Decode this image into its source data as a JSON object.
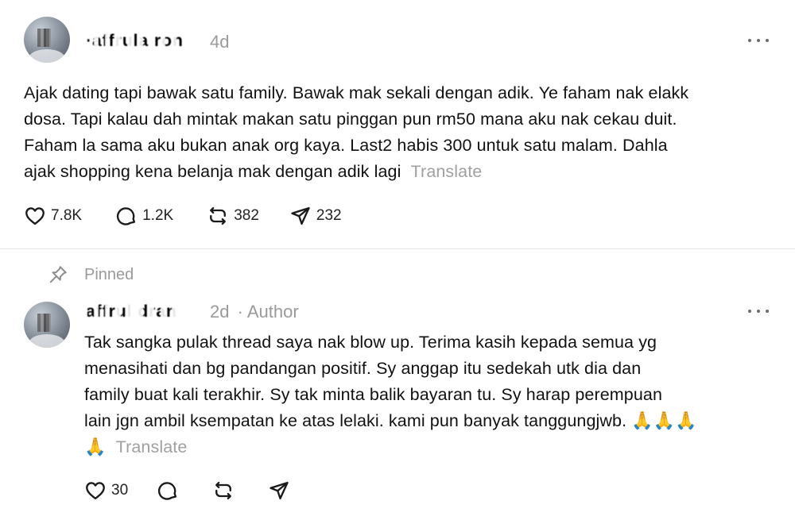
{
  "post1": {
    "username": "·affrula ron",
    "time": "4d",
    "lines": [
      "Ajak dating tapi bawak satu family. Bawak mak sekali dengan adik. Ye faham nak elakk",
      "dosa. Tapi kalau dah mintak makan satu pinggan pun rm50 mana aku nak cekau duit.",
      "Faham la sama aku bukan anak org kaya. Last2 habis 300 untuk satu malam. Dahla",
      "ajak shopping kena belanja mak dengan adik lagi"
    ],
    "translate": "Translate",
    "likes": "7.8K",
    "replies": "1.2K",
    "reposts": "382",
    "shares": "232"
  },
  "pinned_label": "Pinned",
  "post2": {
    "username": "affrul dran",
    "time": "2d",
    "author_tag": "· Author",
    "lines": [
      "Tak sangka pulak thread saya nak blow up. Terima kasih kepada semua yg",
      "menasihati dan bg pandangan positif. Sy anggap itu sedekah utk dia dan",
      "family buat kali terakhir. Sy tak minta balik bayaran tu. Sy harap perempuan",
      "lain jgn ambil ksempatan ke atas lelaki. kami pun banyak tanggungjwb."
    ],
    "emoji_inline": "🙏🙏🙏",
    "emoji_next": "🙏",
    "translate": "Translate",
    "likes": "30"
  },
  "icons": [
    "heart-icon",
    "comment-icon",
    "repost-icon",
    "share-icon",
    "more-icon",
    "pin-icon"
  ]
}
